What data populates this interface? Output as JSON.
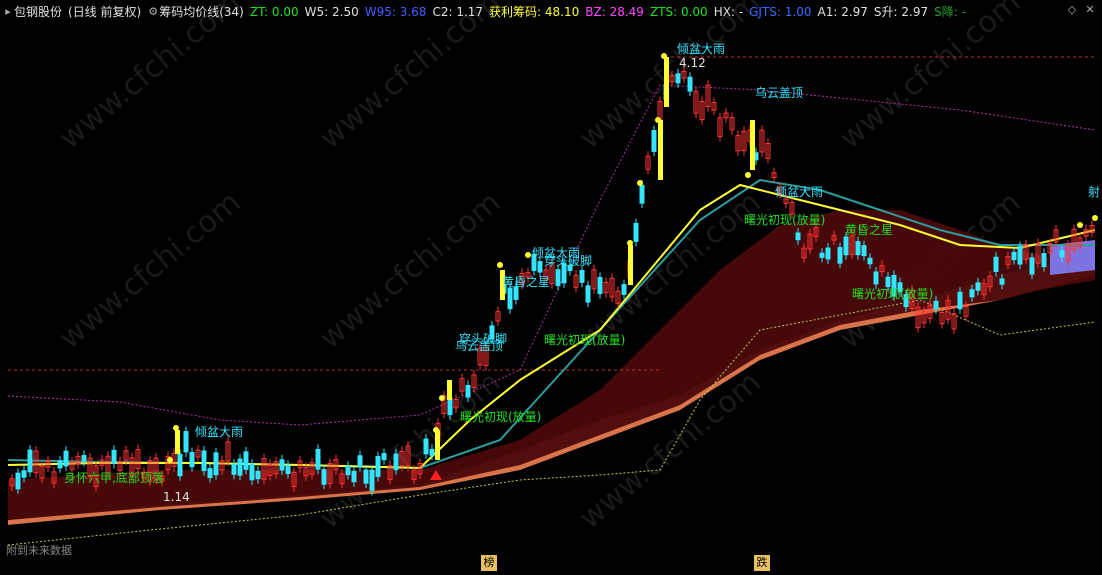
{
  "header": {
    "stock": "包钢股份",
    "period": "(日线 前复权)",
    "indicator": "筹码均价线(34)",
    "items": [
      {
        "label": "ZT: 0.00",
        "color": "#21e021"
      },
      {
        "label": "W5: 2.50",
        "color": "#e0e0e0"
      },
      {
        "label": "W95: 3.68",
        "color": "#4060ff"
      },
      {
        "label": "C2: 1.17",
        "color": "#e0e0e0"
      },
      {
        "label": "获利筹码: 48.10",
        "color": "#ffff33"
      },
      {
        "label": "BZ: 28.49",
        "color": "#ff44ff"
      },
      {
        "label": "ZTS: 0.00",
        "color": "#21e021"
      },
      {
        "label": "HX: -",
        "color": "#e0e0e0"
      },
      {
        "label": "GJTS: 1.00",
        "color": "#3b6bff"
      },
      {
        "label": "A1: 2.97",
        "color": "#e0e0e0"
      },
      {
        "label": "S升: 2.97",
        "color": "#e0e0e0"
      },
      {
        "label": "S降: -",
        "color": "#21a021"
      }
    ]
  },
  "annotations": {
    "a1": "倾盆大雨",
    "a2": "4.12",
    "a3": "乌云盖顶",
    "a4": "倾盆大雨",
    "a5": "曙光初现(放量)",
    "a6": "黄昏之星",
    "a7": "曙光初现(放量)",
    "a8": "射",
    "a9": "倾盆大雨",
    "a10": "穿头破脚",
    "a11": "黄昏之星",
    "a12": "曙光初现(放量)",
    "a13": "穿头破脚",
    "a14": "乌云盖顶",
    "a15": "曙光初现(放量)",
    "a16": "倾盆大雨",
    "a17": "身怀六甲,底部顶落",
    "a18": "1.14"
  },
  "footer": {
    "note": "附到未来数据",
    "tag1": "榜",
    "tag2": "跌"
  },
  "watermark": "www.cfchi.com",
  "colors": {
    "bg": "#000000",
    "up": "#ff3333",
    "down": "#33e5ff",
    "ma": "#ffff33"
  }
}
